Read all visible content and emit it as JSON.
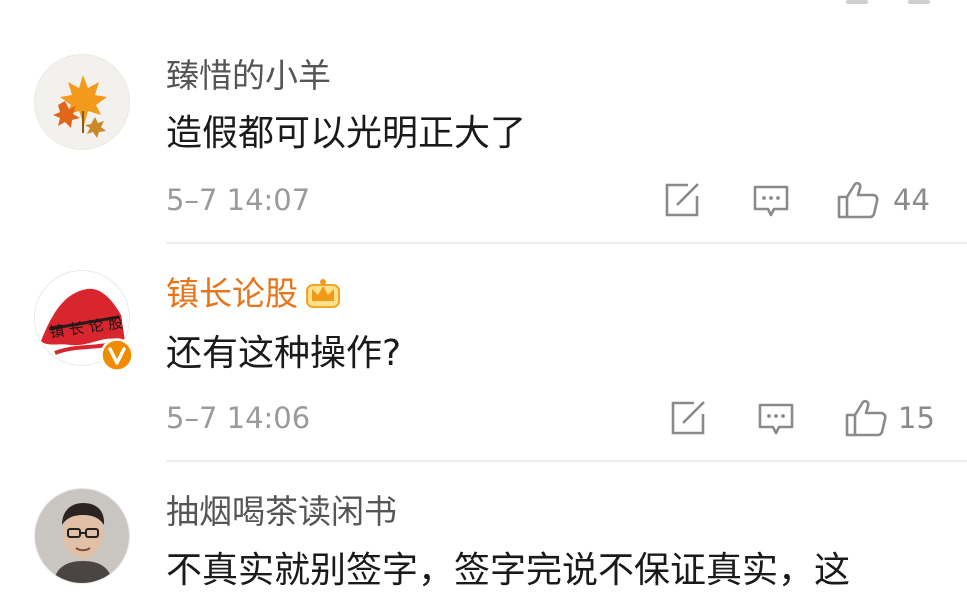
{
  "comments": [
    {
      "username": "臻惜的小羊",
      "text": "造假都可以光明正大了",
      "time": "5–7 14:07",
      "likes": "44",
      "avatar": "maple-leaf-icon",
      "verified": false
    },
    {
      "username": "镇长论股",
      "text": "还有这种操作?",
      "time": "5–7 14:06",
      "likes": "15",
      "avatar": "calligraphy-logo-avatar",
      "verified": true,
      "badge": "crown-icon"
    },
    {
      "username": "抽烟喝茶读闲书",
      "text": "不真实就别签字，签字完说不保证真实，这",
      "avatar": "person-photo-avatar",
      "verified": false
    }
  ],
  "colors": {
    "vip_name": "#e8741b",
    "verified_badge": "#f08c00",
    "muted": "#9a9a9a",
    "divider": "#ececec"
  }
}
